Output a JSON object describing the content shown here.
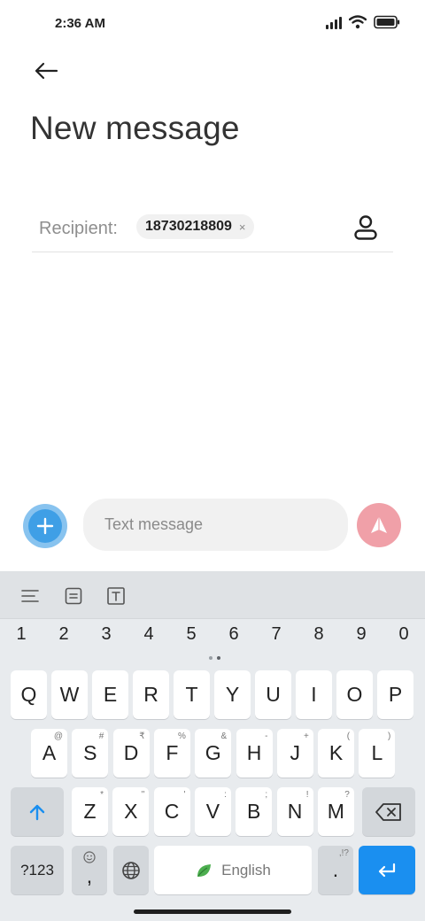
{
  "status_bar": {
    "time": "2:36 AM"
  },
  "header": {
    "title": "New message"
  },
  "recipient": {
    "label": "Recipient:",
    "chip_text": "18730218809",
    "chip_close": "×"
  },
  "composer": {
    "placeholder": "Text message"
  },
  "keyboard": {
    "number_row": [
      "1",
      "2",
      "3",
      "4",
      "5",
      "6",
      "7",
      "8",
      "9",
      "0"
    ],
    "row1": [
      "Q",
      "W",
      "E",
      "R",
      "T",
      "Y",
      "U",
      "I",
      "O",
      "P"
    ],
    "row2": [
      {
        "key": "A",
        "hint": "@"
      },
      {
        "key": "S",
        "hint": "#"
      },
      {
        "key": "D",
        "hint": "₹"
      },
      {
        "key": "F",
        "hint": "%"
      },
      {
        "key": "G",
        "hint": "&"
      },
      {
        "key": "H",
        "hint": "-"
      },
      {
        "key": "J",
        "hint": "+"
      },
      {
        "key": "K",
        "hint": "("
      },
      {
        "key": "L",
        "hint": ")"
      }
    ],
    "row3": [
      {
        "key": "Z",
        "hint": "*"
      },
      {
        "key": "X",
        "hint": "\""
      },
      {
        "key": "C",
        "hint": "'"
      },
      {
        "key": "V",
        "hint": ":"
      },
      {
        "key": "B",
        "hint": ";"
      },
      {
        "key": "N",
        "hint": "!"
      },
      {
        "key": "M",
        "hint": "?"
      }
    ],
    "symbols_label": "?123",
    "comma_key": ",",
    "period_key": ".",
    "period_hint": ",!?",
    "space_label": "English"
  },
  "colors": {
    "attach": "#3f9fe6",
    "send": "#f0a0a8",
    "enter": "#1a8ff0"
  }
}
